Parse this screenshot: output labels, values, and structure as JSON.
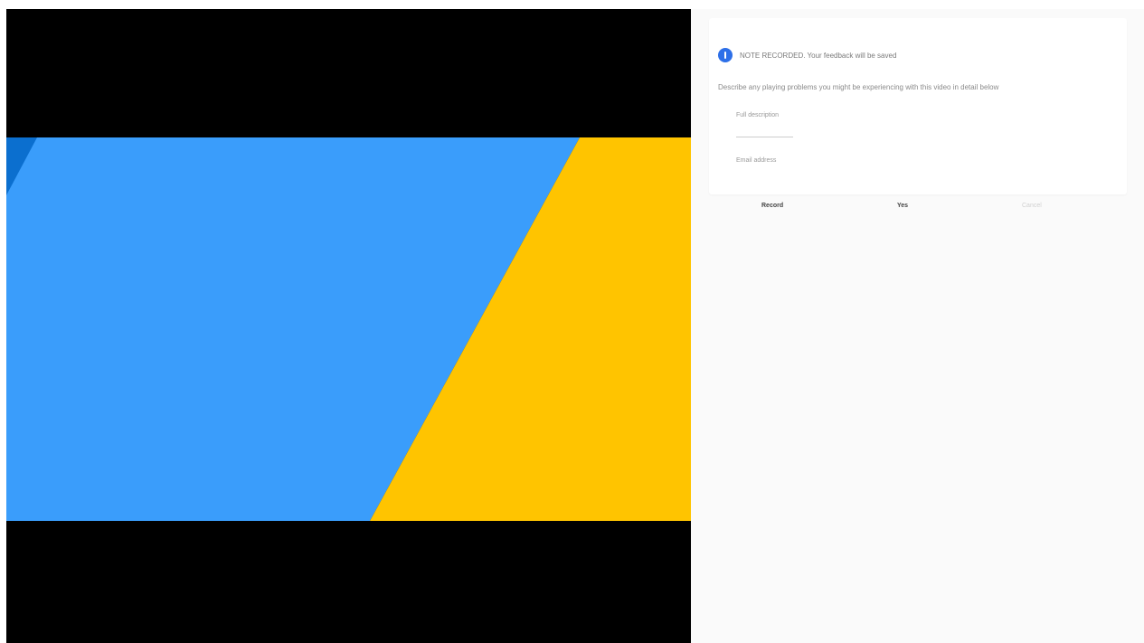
{
  "colors": {
    "letterbox": "#000000",
    "blue_shape": "#3a9dfb",
    "dark_blue_corner": "#0b6fcf",
    "yellow_shape": "#ffc400",
    "accent": "#2d6fe8",
    "panel_bg": "#fafafa"
  },
  "media": {
    "content_name": "video-frame"
  },
  "panel": {
    "header": {
      "icon": "info-icon",
      "text": "NOTE RECORDED. Your feedback will be saved"
    },
    "description": "Describe any playing problems you might be experiencing with this video in detail below",
    "fields": [
      {
        "label": "Full description"
      },
      {
        "label": "—————————"
      },
      {
        "label": "Email address"
      }
    ],
    "actions": [
      {
        "label": "Record"
      },
      {
        "label": "Yes"
      },
      {
        "label": "Cancel"
      }
    ]
  }
}
